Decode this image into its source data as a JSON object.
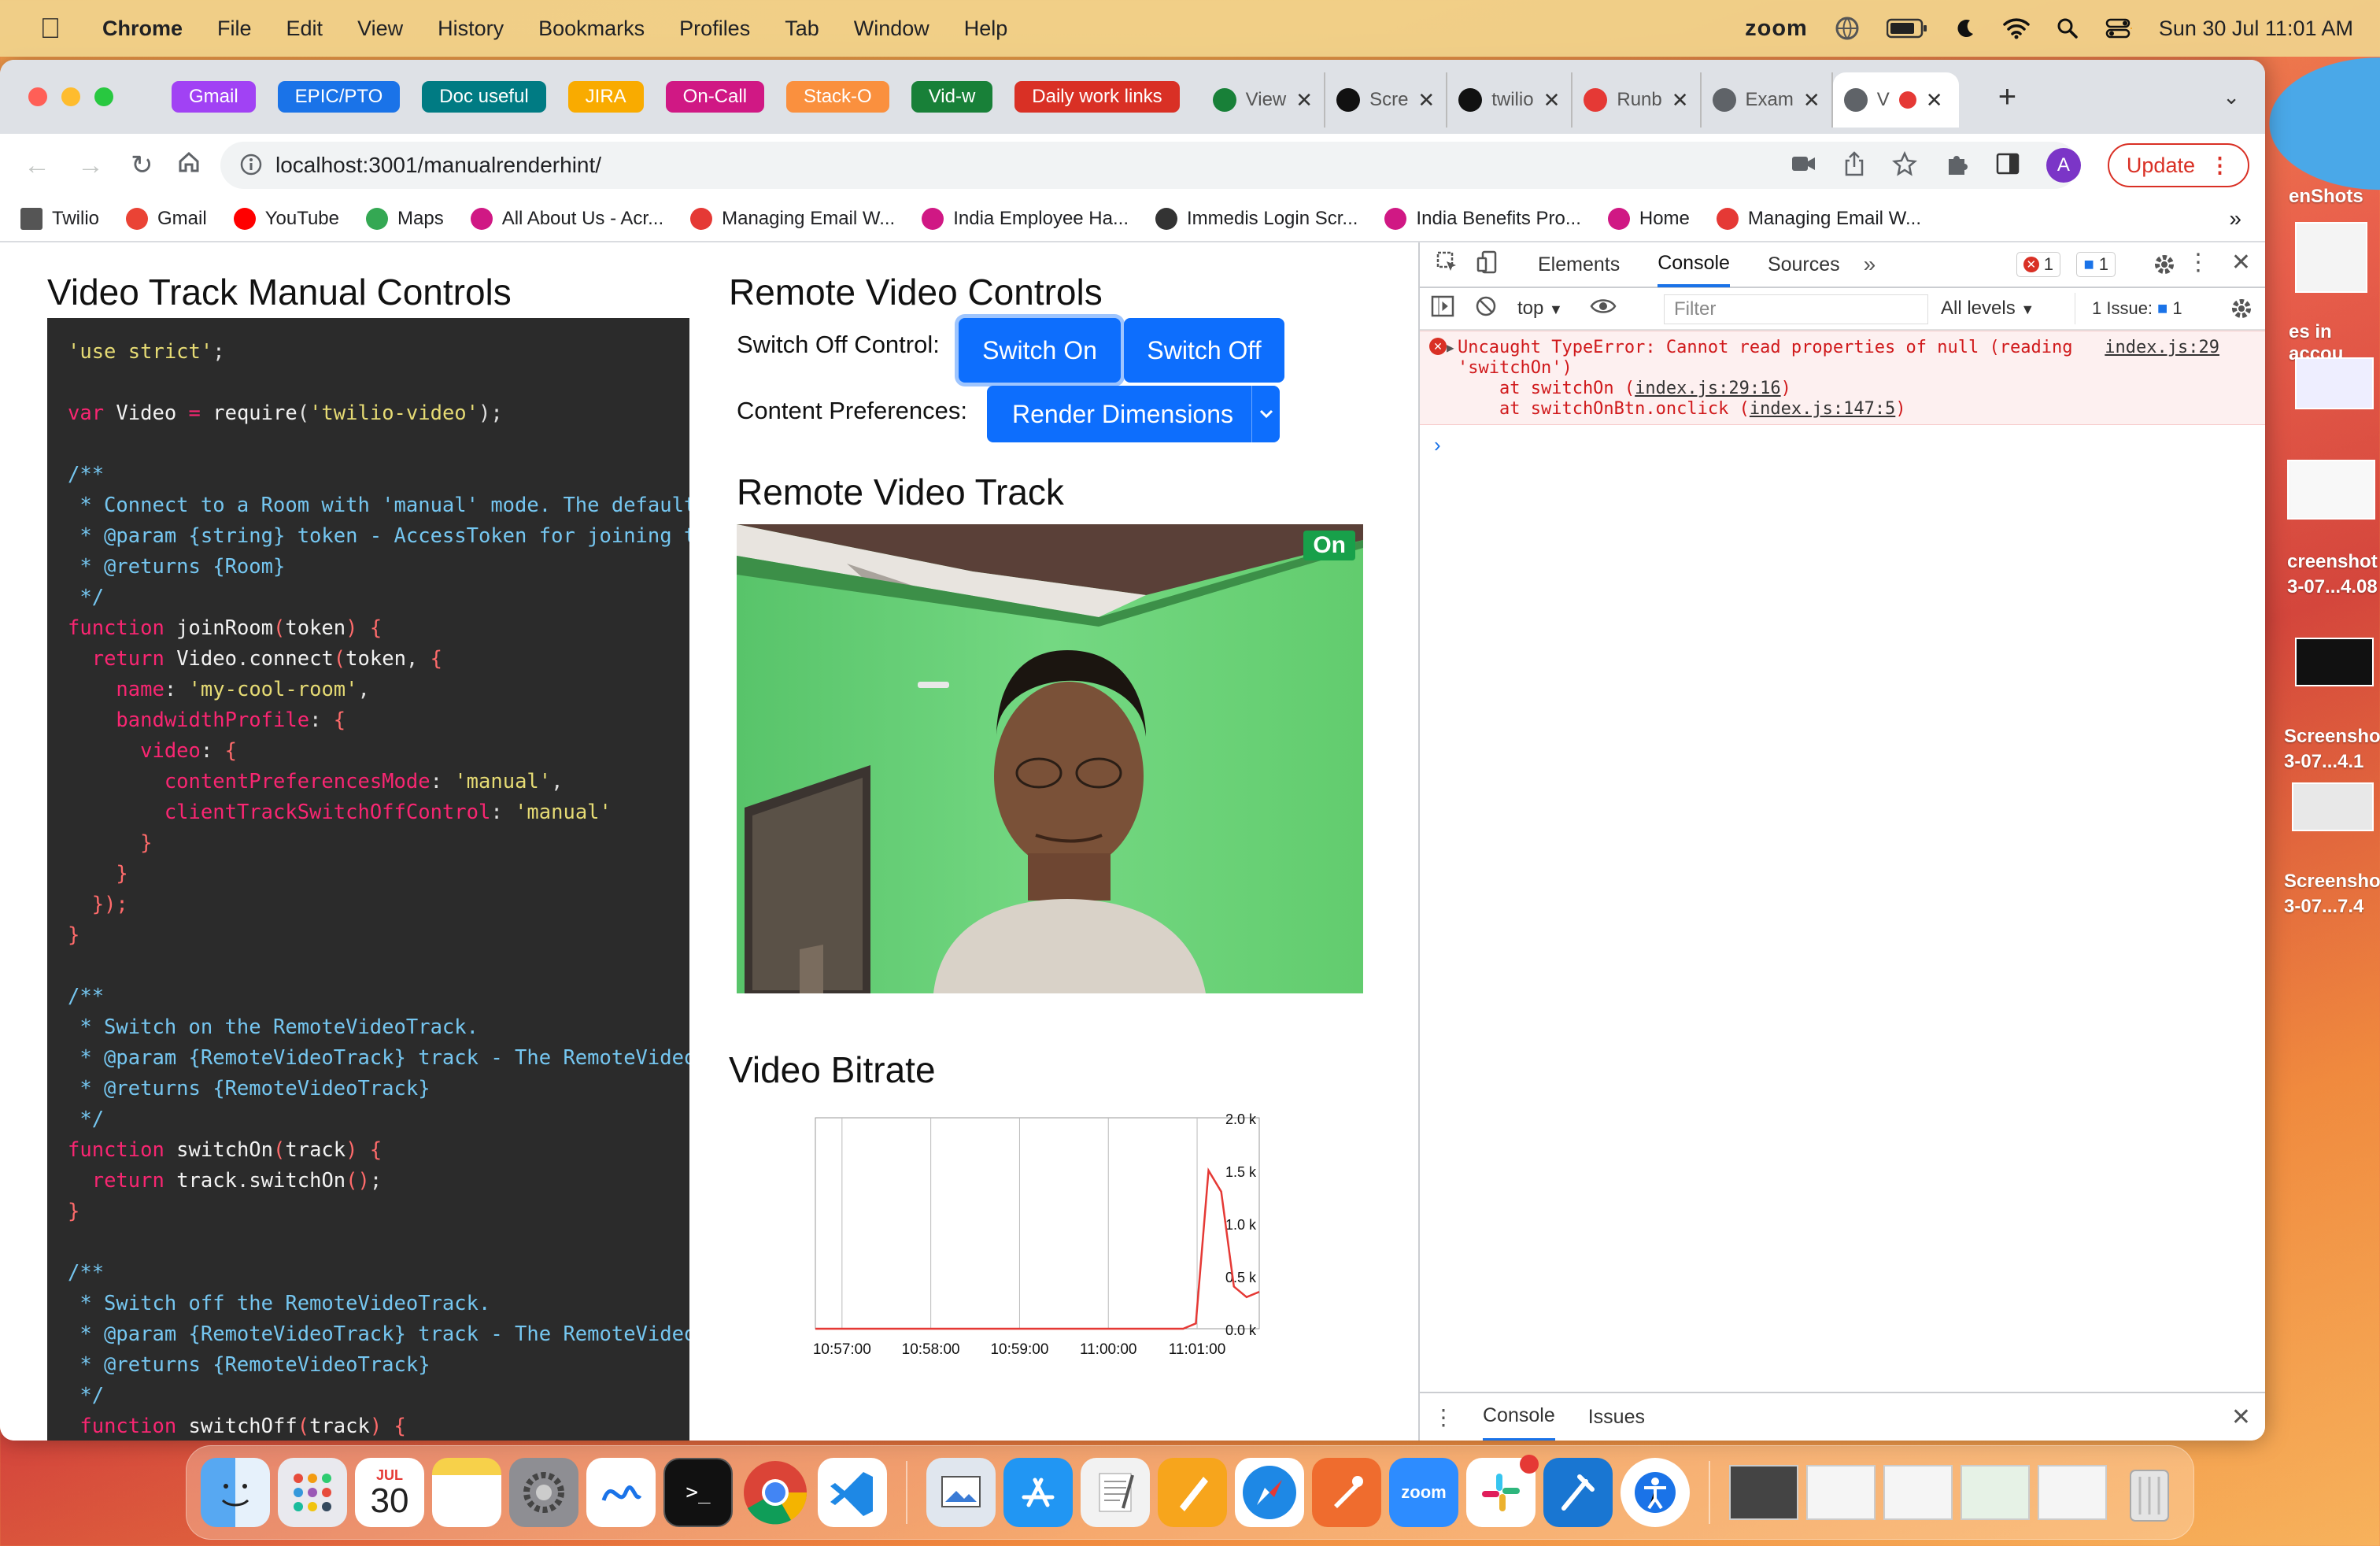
{
  "menubar": {
    "app": "Chrome",
    "items": [
      "File",
      "Edit",
      "View",
      "History",
      "Bookmarks",
      "Profiles",
      "Tab",
      "Window",
      "Help"
    ],
    "zoom": "zoom",
    "datetime": "Sun 30 Jul  11:01 AM"
  },
  "tabs": {
    "groups": [
      {
        "label": "Gmail",
        "color": "#a142f4"
      },
      {
        "label": "EPIC/PTO",
        "color": "#1a73e8"
      },
      {
        "label": "Doc useful",
        "color": "#007b83"
      },
      {
        "label": "JIRA",
        "color": "#f9ab00"
      },
      {
        "label": "On-Call",
        "color": "#d01884"
      },
      {
        "label": "Stack-O",
        "color": "#fa903e"
      },
      {
        "label": "Vid-w",
        "color": "#188038"
      },
      {
        "label": "Daily work links",
        "color": "#d93025"
      }
    ],
    "pages": [
      {
        "title": "View",
        "icon": "sheets-icon"
      },
      {
        "title": "Scre",
        "icon": "github-icon"
      },
      {
        "title": "twilio",
        "icon": "github-icon"
      },
      {
        "title": "Runb",
        "icon": "confluence-icon"
      },
      {
        "title": "Exam",
        "icon": "globe-icon"
      },
      {
        "title": "V",
        "icon": "globe-icon",
        "active": true
      }
    ]
  },
  "address": {
    "url": "localhost:3001/manualrenderhint/"
  },
  "toolbar": {
    "avatar": "A",
    "update_label": "Update"
  },
  "bookmarks": [
    "Twilio",
    "Gmail",
    "YouTube",
    "Maps",
    "All About Us - Acr...",
    "Managing Email W...",
    "India Employee Ha...",
    "Immedis Login Scr...",
    "India Benefits Pro...",
    "Home",
    "Managing Email W..."
  ],
  "left": {
    "title": "Video Track Manual Controls"
  },
  "right": {
    "title": "Remote Video Controls",
    "switch_label": "Switch Off Control:",
    "switch_on": "Switch On",
    "switch_off": "Switch Off",
    "content_label": "Content Preferences:",
    "render_select": "Render Dimensions",
    "track_title": "Remote Video Track",
    "badge": "On",
    "bitrate_title": "Video Bitrate"
  },
  "chart_data": {
    "type": "line",
    "title": "",
    "x": [
      "10:57:00",
      "10:58:00",
      "10:59:00",
      "11:00:00",
      "11:01:00"
    ],
    "y_ticks": [
      "0.0 k",
      "0.5 k",
      "1.0 k",
      "1.5 k",
      "2.0 k"
    ],
    "ylim": [
      0,
      2.0
    ],
    "series": [
      {
        "values": [
          0,
          0,
          0,
          0,
          0,
          0,
          0,
          0,
          0,
          0,
          0,
          0,
          0,
          0,
          0,
          0,
          0,
          0,
          0,
          0,
          0,
          0,
          0,
          0,
          0,
          0,
          0,
          0,
          0,
          0,
          0.05,
          1.5,
          1.3,
          0.4,
          0.3,
          0.35
        ]
      }
    ],
    "color": "#e53935"
  },
  "devtools": {
    "tabs": [
      "Elements",
      "Console",
      "Sources"
    ],
    "active": "Console",
    "errors": "1",
    "messages": "1",
    "context": "top",
    "filter_placeholder": "Filter",
    "levels": "All levels",
    "issues": "1 Issue:",
    "issues_count": "1",
    "error": {
      "line1": "Uncaught TypeError: Cannot read properties of null (reading",
      "line2": "'switchOn')",
      "at1_pre": "    at switchOn (",
      "at1_link": "index.js:29:16",
      "at1_post": ")",
      "at2_pre": "    at switchOnBtn.onclick (",
      "at2_link": "index.js:147:5",
      "at2_post": ")",
      "source": "index.js:29"
    },
    "drawer": [
      "Console",
      "Issues"
    ]
  },
  "dock": {
    "calendar_month": "JUL",
    "calendar_day": "30",
    "zoom": "zoom"
  },
  "desktop": [
    "enShots",
    "es in accou",
    "creenshot",
    "3-07...4.08",
    "Screensho",
    "3-07...4.1",
    "Screensho",
    "3-07...7.4"
  ]
}
